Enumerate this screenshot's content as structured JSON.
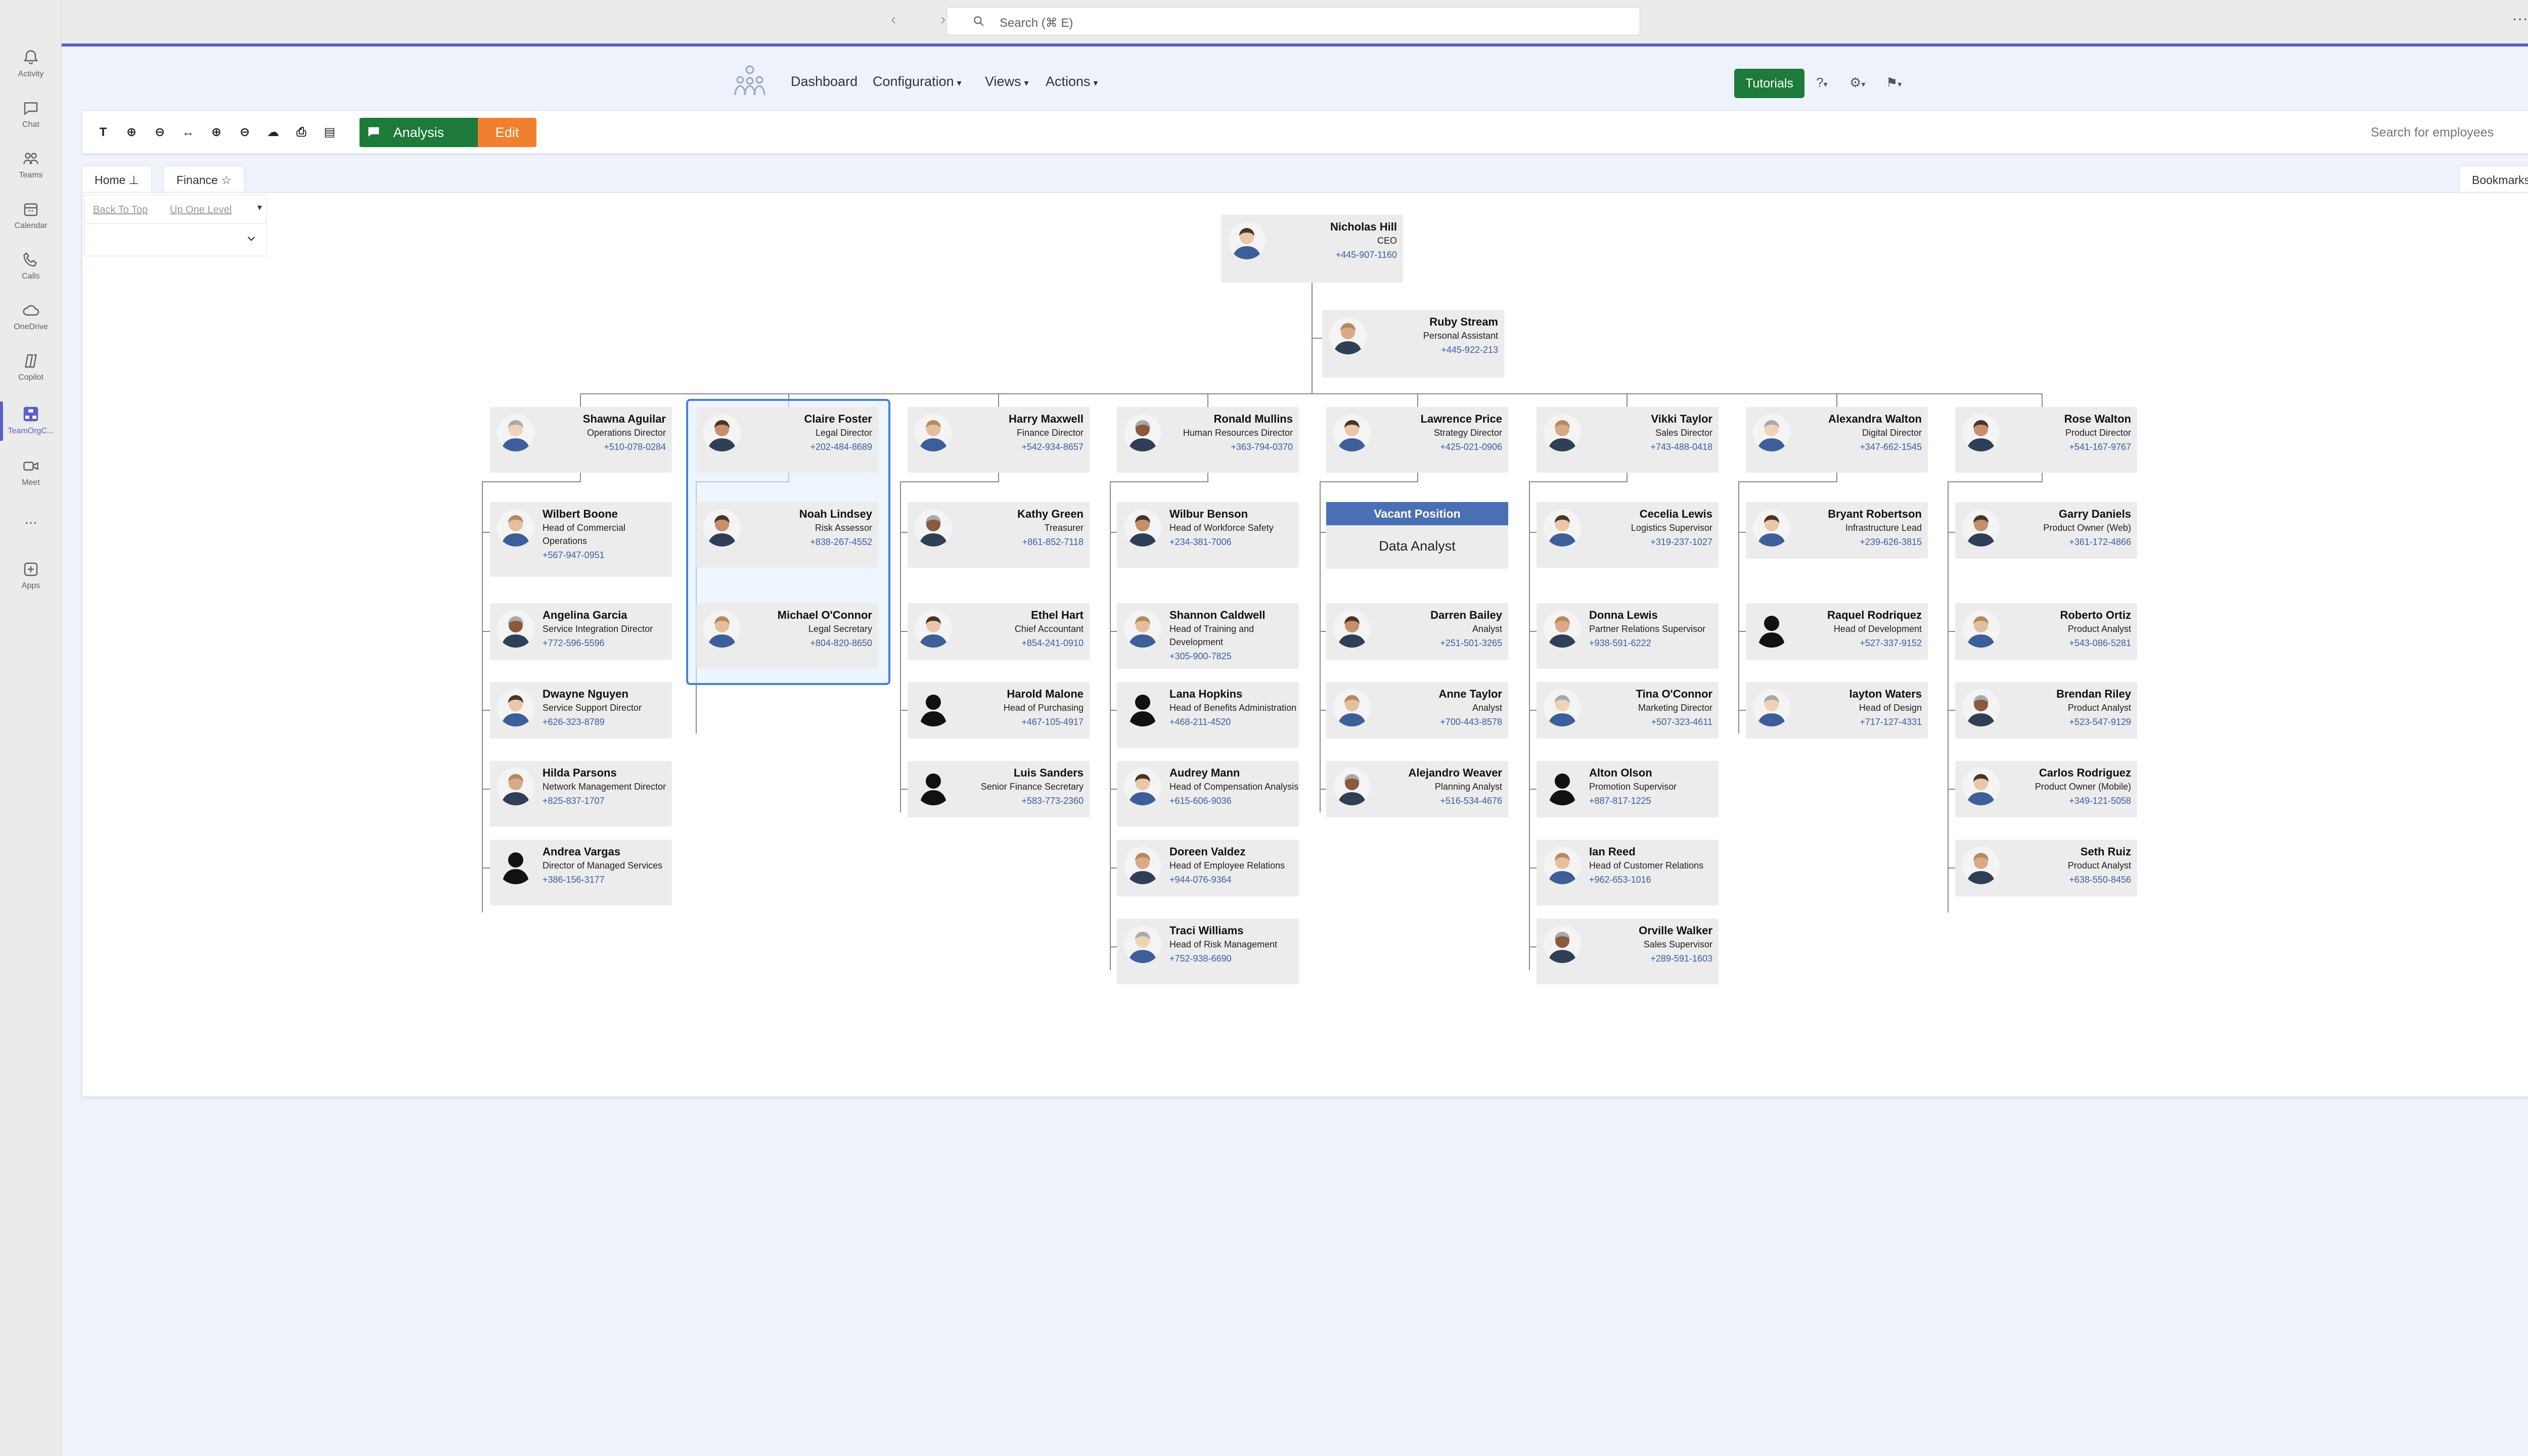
{
  "rail": [
    {
      "label": "Activity",
      "icon": "bell-icon"
    },
    {
      "label": "Chat",
      "icon": "chat-icon"
    },
    {
      "label": "Teams",
      "icon": "teams-icon"
    },
    {
      "label": "Calendar",
      "icon": "calendar-icon"
    },
    {
      "label": "Calls",
      "icon": "phone-icon"
    },
    {
      "label": "OneDrive",
      "icon": "cloud-icon"
    },
    {
      "label": "Copilot",
      "icon": "copilot-icon"
    },
    {
      "label": "TeamOrgC...",
      "icon": "orgchart-app-icon"
    },
    {
      "label": "Meet",
      "icon": "video-icon"
    },
    {
      "label": "...",
      "icon": "more-icon"
    },
    {
      "label": "Apps",
      "icon": "apps-icon"
    }
  ],
  "titlebar": {
    "search_placeholder": "Search (⌘ E)",
    "more": "···"
  },
  "menu": {
    "dashboard": "Dashboard",
    "configuration": "Configuration",
    "views": "Views",
    "actions": "Actions",
    "tutorials": "Tutorials"
  },
  "toolbar": {
    "analysis": "Analysis",
    "edit": "Edit",
    "search_placeholder": "Search for employees"
  },
  "tabs": {
    "home": "Home",
    "finance": "Finance",
    "bookmarks": "Bookmarks"
  },
  "nav": {
    "back_to_top": "Back To Top",
    "up_one_level": "Up One Level"
  },
  "colors": {
    "accent": "#5b5fc7",
    "green": "#1d7a3a",
    "orange": "#f08030",
    "vacant": "#4a6fb5",
    "phone": "#3a5fa8"
  },
  "people": {
    "ceo": {
      "name": "Nicholas Hill",
      "title": "CEO",
      "phone": "+445-907-1160"
    },
    "pa": {
      "name": "Ruby Stream",
      "title": "Personal Assistant",
      "phone": "+445-922-213"
    },
    "shawna": {
      "name": "Shawna Aguilar",
      "title": "Operations Director",
      "phone": "+510-078-0284"
    },
    "claire": {
      "name": "Claire Foster",
      "title": "Legal Director",
      "phone": "+202-484-8689"
    },
    "harry": {
      "name": "Harry Maxwell",
      "title": "Finance Director",
      "phone": "+542-934-8657"
    },
    "ronald": {
      "name": "Ronald Mullins",
      "title": "Human Resources Director",
      "phone": "+363-794-0370"
    },
    "lawrence": {
      "name": "Lawrence Price",
      "title": "Strategy Director",
      "phone": "+425-021-0906"
    },
    "vikki": {
      "name": "Vikki Taylor",
      "title": "Sales Director",
      "phone": "+743-488-0418"
    },
    "alexandra": {
      "name": "Alexandra Walton",
      "title": "Digital Director",
      "phone": "+347-662-1545"
    },
    "rose": {
      "name": "Rose Walton",
      "title": "Product Director",
      "phone": "+541-167-9767"
    },
    "wilbert": {
      "name": "Wilbert Boone",
      "title": "Head of Commercial Operations",
      "phone": "+567-947-0951"
    },
    "angelina": {
      "name": "Angelina Garcia",
      "title": "Service Integration Director",
      "phone": "+772-596-5596"
    },
    "dwayne": {
      "name": "Dwayne Nguyen",
      "title": "Service Support Director",
      "phone": "+626-323-8789"
    },
    "hilda": {
      "name": "Hilda Parsons",
      "title": "Network Management Director",
      "phone": "+825-837-1707"
    },
    "andrea": {
      "name": "Andrea Vargas",
      "title": "Director of Managed Services",
      "phone": "+386-156-3177"
    },
    "noah": {
      "name": "Noah Lindsey",
      "title": "Risk Assessor",
      "phone": "+838-267-4552"
    },
    "michael": {
      "name": "Michael O'Connor",
      "title": "Legal Secretary",
      "phone": "+804-820-8650"
    },
    "kathy": {
      "name": "Kathy Green",
      "title": "Treasurer",
      "phone": "+861-852-7118"
    },
    "ethel": {
      "name": "Ethel Hart",
      "title": "Chief Accountant",
      "phone": "+854-241-0910"
    },
    "harold": {
      "name": "Harold Malone",
      "title": "Head of Purchasing",
      "phone": "+467-105-4917"
    },
    "luis": {
      "name": "Luis Sanders",
      "title": "Senior Finance Secretary",
      "phone": "+583-773-2360"
    },
    "wilbur": {
      "name": "Wilbur Benson",
      "title": "Head of Workforce Safety",
      "phone": "+234-381-7006"
    },
    "shannon": {
      "name": "Shannon Caldwell",
      "title": "Head of Training and Development",
      "phone": "+305-900-7825"
    },
    "lana": {
      "name": "Lana Hopkins",
      "title": "Head of Benefits Administration",
      "phone": "+468-211-4520"
    },
    "audrey": {
      "name": "Audrey Mann",
      "title": "Head of Compensation Analysis",
      "phone": "+615-606-9036"
    },
    "doreen": {
      "name": "Doreen Valdez",
      "title": "Head of Employee Relations",
      "phone": "+944-076-9364"
    },
    "traci": {
      "name": "Traci Williams",
      "title": "Head of Risk Management",
      "phone": "+752-938-6690"
    },
    "vacant": {
      "header": "Vacant Position",
      "title": "Data Analyst"
    },
    "darren": {
      "name": "Darren Bailey",
      "title": "Analyst",
      "phone": "+251-501-3265"
    },
    "anne": {
      "name": "Anne Taylor",
      "title": "Analyst",
      "phone": "+700-443-8578"
    },
    "alejandro": {
      "name": "Alejandro Weaver",
      "title": "Planning Analyst",
      "phone": "+516-534-4676"
    },
    "cecelia": {
      "name": "Cecelia Lewis",
      "title": "Logistics Supervisor",
      "phone": "+319-237-1027"
    },
    "donna": {
      "name": "Donna Lewis",
      "title": "Partner Relations Supervisor",
      "phone": "+938-591-6222"
    },
    "tina": {
      "name": "Tina O'Connor",
      "title": "Marketing Director",
      "phone": "+507-323-4611"
    },
    "alton": {
      "name": "Alton Olson",
      "title": "Promotion Supervisor",
      "phone": "+887-817-1225"
    },
    "ian": {
      "name": "Ian Reed",
      "title": "Head of Customer Relations",
      "phone": "+962-653-1016"
    },
    "orville": {
      "name": "Orville Walker",
      "title": "Sales Supervisor",
      "phone": "+289-591-1603"
    },
    "bryant": {
      "name": "Bryant Robertson",
      "title": "Infrastructure Lead",
      "phone": "+239-626-3815"
    },
    "raquel": {
      "name": "Raquel Rodriquez",
      "title": "Head of Development",
      "phone": "+527-337-9152"
    },
    "layton": {
      "name": "layton Waters",
      "title": "Head of Design",
      "phone": "+717-127-4331"
    },
    "garry": {
      "name": "Garry Daniels",
      "title": "Product Owner (Web)",
      "phone": "+361-172-4866"
    },
    "roberto": {
      "name": "Roberto Ortiz",
      "title": "Product Analyst",
      "phone": "+543-086-5281"
    },
    "brendan": {
      "name": "Brendan Riley",
      "title": "Product Analyst",
      "phone": "+523-547-9129"
    },
    "carlos": {
      "name": "Carlos Rodriguez",
      "title": "Product Owner (Mobile)",
      "phone": "+349-121-5058"
    },
    "seth": {
      "name": "Seth Ruiz",
      "title": "Product Analyst",
      "phone": "+638-550-8456"
    }
  }
}
